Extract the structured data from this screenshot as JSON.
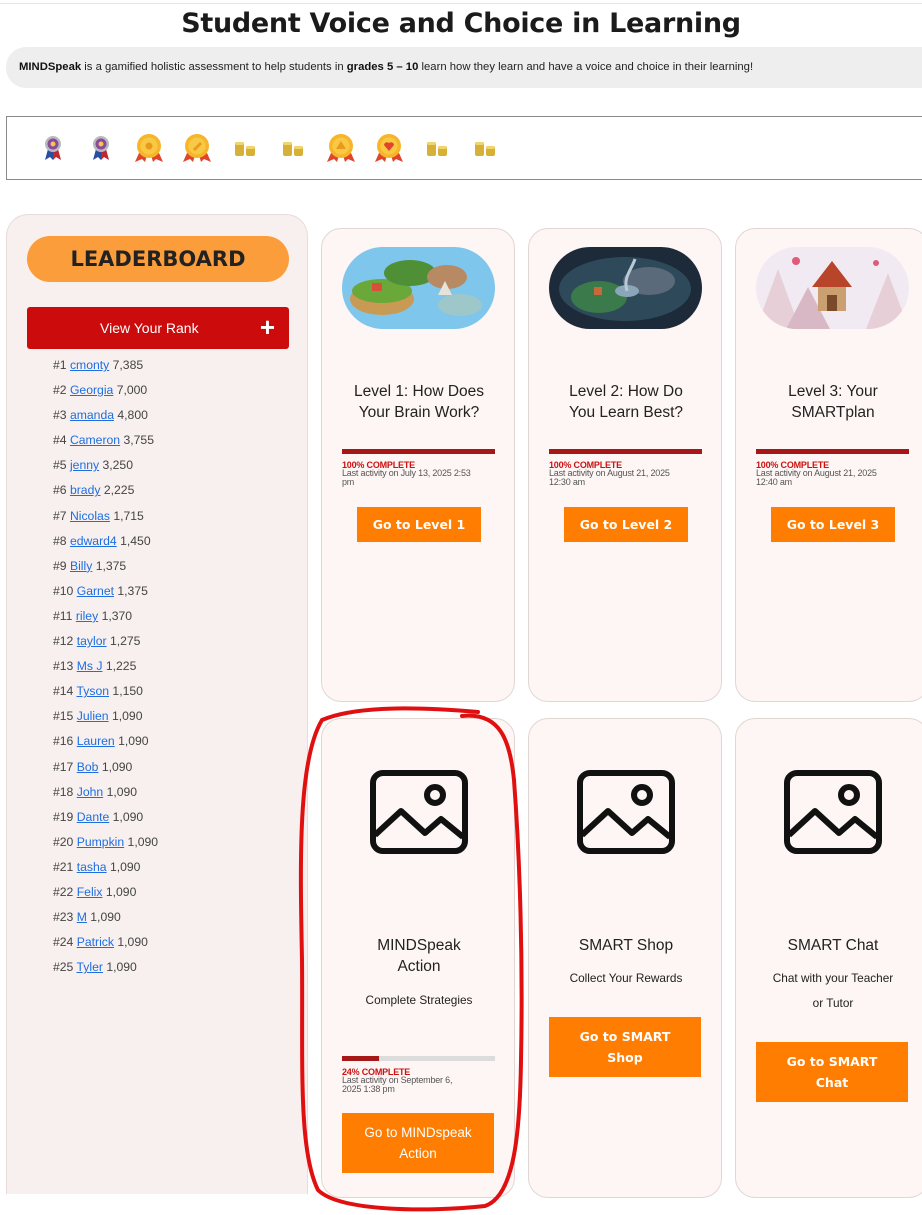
{
  "page": {
    "title": "Student Voice and Choice in Learning",
    "intro": {
      "brand": "MINDSpeak",
      "text_a": " is a gamified holistic assessment to help students in ",
      "grades": "grades 5 – 10",
      "text_b": " learn how they learn and have a voice and choice in their learning!"
    }
  },
  "badges": [
    {
      "icon": "ribbon-medal-icon"
    },
    {
      "icon": "ribbon-medal-icon"
    },
    {
      "icon": "gold-medal-icon"
    },
    {
      "icon": "gold-medal-icon"
    },
    {
      "icon": "coin-stack-icon"
    },
    {
      "icon": "coin-stack-icon"
    },
    {
      "icon": "gold-medal-icon"
    },
    {
      "icon": "gold-medal-icon"
    },
    {
      "icon": "coin-stack-icon"
    },
    {
      "icon": "coin-stack-icon"
    }
  ],
  "leaderboard": {
    "title": "LEADERBOARD",
    "rank_button": "View Your Rank",
    "rank_button_icon": "plus-icon",
    "entries": [
      {
        "rank": "#1",
        "name": "cmonty",
        "score": "7,385"
      },
      {
        "rank": "#2",
        "name": "Georgia",
        "score": "7,000"
      },
      {
        "rank": "#3",
        "name": "amanda",
        "score": "4,800"
      },
      {
        "rank": "#4",
        "name": "Cameron",
        "score": "3,755"
      },
      {
        "rank": "#5",
        "name": "jenny",
        "score": "3,250"
      },
      {
        "rank": "#6",
        "name": "brady",
        "score": "2,225"
      },
      {
        "rank": "#7",
        "name": "Nicolas",
        "score": "1,715"
      },
      {
        "rank": "#8",
        "name": "edward4",
        "score": "1,450"
      },
      {
        "rank": "#9",
        "name": "Billy",
        "score": "1,375"
      },
      {
        "rank": "#10",
        "name": "Garnet",
        "score": "1,375"
      },
      {
        "rank": "#11",
        "name": "riley",
        "score": "1,370"
      },
      {
        "rank": "#12",
        "name": "taylor",
        "score": "1,275"
      },
      {
        "rank": "#13",
        "name": "Ms J",
        "score": "1,225"
      },
      {
        "rank": "#14",
        "name": "Tyson",
        "score": "1,150"
      },
      {
        "rank": "#15",
        "name": "Julien",
        "score": "1,090"
      },
      {
        "rank": "#16",
        "name": "Lauren",
        "score": "1,090"
      },
      {
        "rank": "#17",
        "name": "Bob",
        "score": "1,090"
      },
      {
        "rank": "#18",
        "name": "John",
        "score": "1,090"
      },
      {
        "rank": "#19",
        "name": "Dante",
        "score": "1,090"
      },
      {
        "rank": "#20",
        "name": "Pumpkin",
        "score": "1,090"
      },
      {
        "rank": "#21",
        "name": "tasha",
        "score": "1,090"
      },
      {
        "rank": "#22",
        "name": "Felix",
        "score": "1,090"
      },
      {
        "rank": "#23",
        "name": "M",
        "score": "1,090"
      },
      {
        "rank": "#24",
        "name": "Patrick",
        "score": "1,090"
      },
      {
        "rank": "#25",
        "name": "Tyler",
        "score": "1,090"
      }
    ]
  },
  "levels": [
    {
      "title_l1": "Level 1: How Does",
      "title_l2": "Your Brain Work?",
      "progress": 1.0,
      "status": "100% COMPLETE",
      "last_l1": "Last activity on July 13, 2025 2:53",
      "last_l2": "pm",
      "button": "Go to Level 1",
      "image_icon": "floating-islands-icon"
    },
    {
      "title_l1": "Level 2: How Do",
      "title_l2": "You Learn Best?",
      "progress": 1.0,
      "status": "100% COMPLETE",
      "last_l1": "Last activity on August 21, 2025",
      "last_l2": "12:30 am",
      "button": "Go to Level 2",
      "image_icon": "vortex-island-icon"
    },
    {
      "title_l1": "Level 3: Your",
      "title_l2": "SMARTplan",
      "progress": 1.0,
      "status": "100% COMPLETE",
      "last_l1": "Last activity on August 21, 2025",
      "last_l2": "12:40 am",
      "button": "Go to Level 3",
      "image_icon": "mountain-temple-icon"
    }
  ],
  "features": [
    {
      "title_l1": "MINDSpeak",
      "title_l2": "Action",
      "subtitle_l1": "Complete Strategies",
      "progress": 0.24,
      "status": "24% COMPLETE",
      "last_l1": "Last activity on September 6,",
      "last_l2": "2025 1:38 pm",
      "button_l1": "Go to MINDspeak",
      "button_l2": "Action",
      "icon": "image-placeholder-icon"
    },
    {
      "title_l1": "SMART Shop",
      "subtitle_l1": "Collect Your Rewards",
      "button_l1": "Go to SMART",
      "button_l2": "Shop",
      "icon": "image-placeholder-icon"
    },
    {
      "title_l1": "SMART Chat",
      "subtitle_l1": "Chat with your Teacher",
      "subtitle_l2": "or Tutor",
      "button_l1": "Go to SMART",
      "button_l2": "Chat",
      "icon": "image-placeholder-icon"
    }
  ],
  "colors": {
    "accent_orange": "#ff7d00",
    "leaderboard_orange": "#fb9d3a",
    "rank_red": "#cc0c0c",
    "progress_red": "#a61818",
    "card_bg": "#fdf6f4",
    "annotation_red": "#e01010"
  }
}
